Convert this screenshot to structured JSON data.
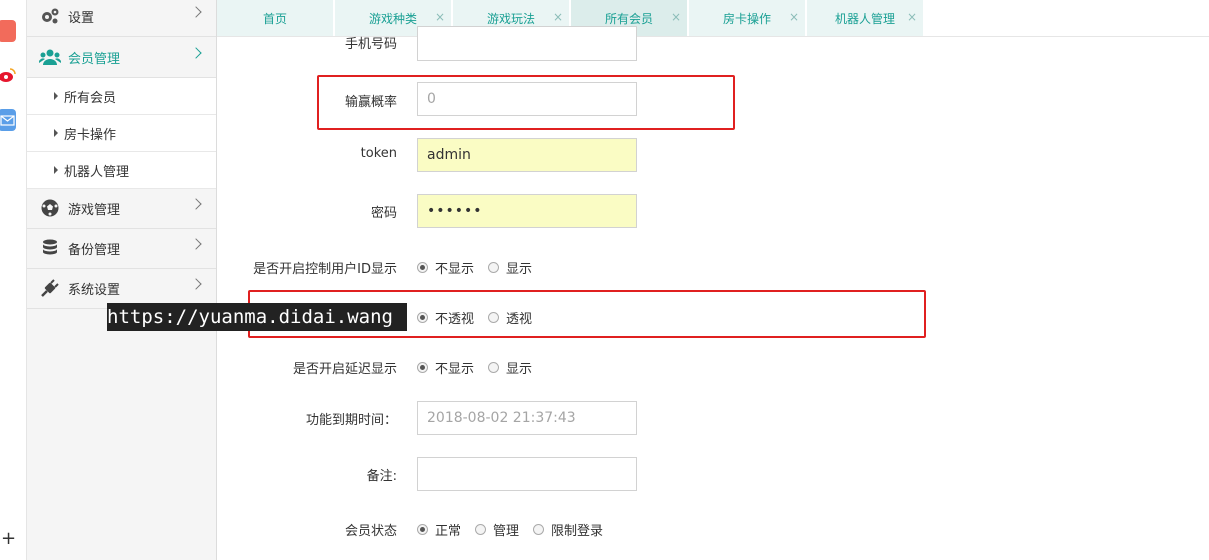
{
  "sidebar": {
    "menu": [
      {
        "label": "设置",
        "icon": "gears-icon"
      },
      {
        "label": "会员管理",
        "icon": "users-icon"
      },
      {
        "label": "游戏管理",
        "icon": "soccer-ball-icon"
      },
      {
        "label": "备份管理",
        "icon": "database-icon"
      },
      {
        "label": "系统设置",
        "icon": "plug-icon"
      }
    ],
    "submenu": [
      {
        "label": "所有会员"
      },
      {
        "label": "房卡操作"
      },
      {
        "label": "机器人管理"
      }
    ]
  },
  "tabs": [
    {
      "label": "首页",
      "closable": false
    },
    {
      "label": "游戏种类",
      "closable": true
    },
    {
      "label": "游戏玩法",
      "closable": true
    },
    {
      "label": "所有会员",
      "closable": true,
      "active": true
    },
    {
      "label": "房卡操作",
      "closable": true
    },
    {
      "label": "机器人管理",
      "closable": true
    }
  ],
  "close_glyph": "×",
  "form": {
    "phone_label": "手机号码",
    "win_rate_label": "输赢概率",
    "win_rate_placeholder": "0",
    "token_label": "token",
    "token_value": "admin",
    "password_label": "密码",
    "password_value": "••••••",
    "ctrl_id_label": "是否开启控制用户ID显示",
    "ctrl_id_options": [
      "不显示",
      "显示"
    ],
    "perspective_options": [
      "不透视",
      "透视"
    ],
    "delay_label": "是否开启延迟显示",
    "delay_options": [
      "不显示",
      "显示"
    ],
    "expire_label": "功能到期时间：",
    "expire_value": "2018-08-02 21:37:43",
    "remark_label": "备注:",
    "status_label": "会员状态",
    "status_options": [
      "正常",
      "管理",
      "限制登录"
    ]
  },
  "watermark": "https://yuanma.didai.wang",
  "colors": {
    "accent": "#1aa094",
    "highlight_box": "#e02020",
    "autofill": "#fafcc4"
  }
}
